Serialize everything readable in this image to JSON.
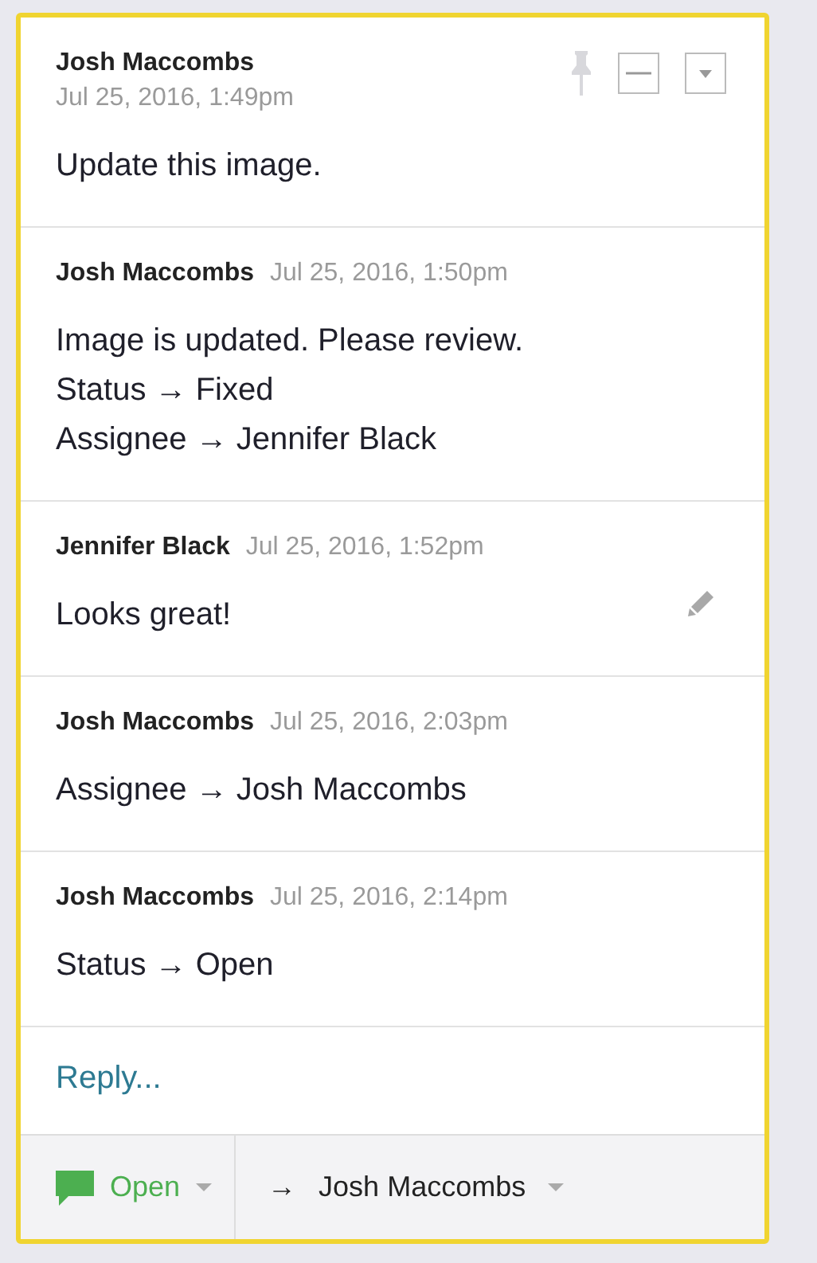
{
  "thread": {
    "messages": [
      {
        "kind": "stacked",
        "author": "Josh Maccombs",
        "time": "Jul 25, 2016, 1:49pm",
        "lines": [
          "Update this image."
        ],
        "editable": false
      },
      {
        "kind": "inline",
        "author": "Josh Maccombs",
        "time": "Jul 25, 2016, 1:50pm",
        "lines": [
          "Image is updated. Please review.",
          "Status → Fixed",
          "Assignee → Jennifer Black"
        ],
        "editable": false
      },
      {
        "kind": "inline",
        "author": "Jennifer Black",
        "time": "Jul 25, 2016, 1:52pm",
        "lines": [
          "Looks great!"
        ],
        "editable": true
      },
      {
        "kind": "inline",
        "author": "Josh Maccombs",
        "time": "Jul 25, 2016, 2:03pm",
        "lines": [
          "Assignee → Josh Maccombs"
        ],
        "editable": false
      },
      {
        "kind": "inline",
        "author": "Josh Maccombs",
        "time": "Jul 25, 2016, 2:14pm",
        "lines": [
          "Status → Open"
        ],
        "editable": false
      }
    ],
    "reply": {
      "placeholder": "Reply..."
    },
    "footer": {
      "status": "Open",
      "assignee_arrow": "→",
      "assignee": "Josh Maccombs"
    }
  }
}
